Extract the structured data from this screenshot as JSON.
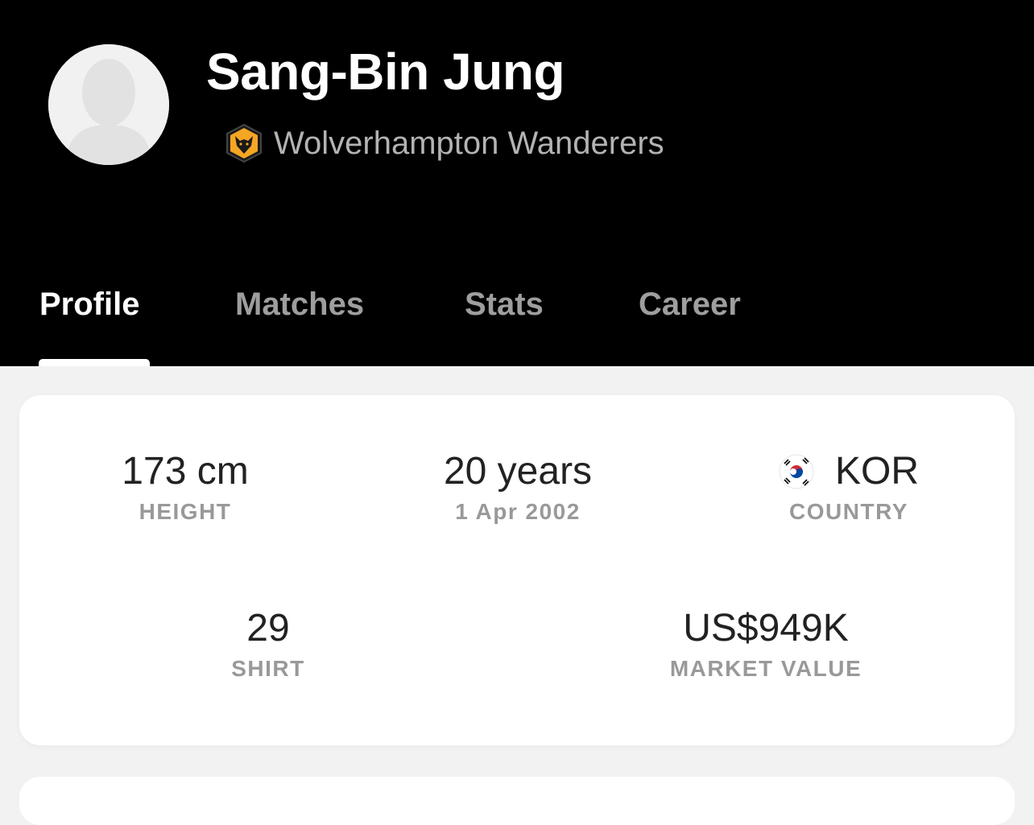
{
  "player": {
    "name": "Sang-Bin Jung",
    "team": "Wolverhampton Wanderers"
  },
  "tabs": [
    {
      "label": "Profile",
      "active": true
    },
    {
      "label": "Matches",
      "active": false
    },
    {
      "label": "Stats",
      "active": false
    },
    {
      "label": "Career",
      "active": false
    }
  ],
  "profile": {
    "height": {
      "value": "173 cm",
      "label": "HEIGHT"
    },
    "age": {
      "value": "20 years",
      "label": "1 Apr 2002"
    },
    "country": {
      "value": "KOR",
      "label": "COUNTRY",
      "flag_icon": "south-korea-flag-icon"
    },
    "shirt": {
      "value": "29",
      "label": "SHIRT"
    },
    "market_value": {
      "value": "US$949K",
      "label": "MARKET VALUE"
    }
  },
  "colors": {
    "header_bg": "#000000",
    "active_tab": "#ffffff",
    "inactive_tab": "#9e9e9e",
    "team_crest": "#f5a623",
    "page_bg": "#f2f2f2"
  }
}
